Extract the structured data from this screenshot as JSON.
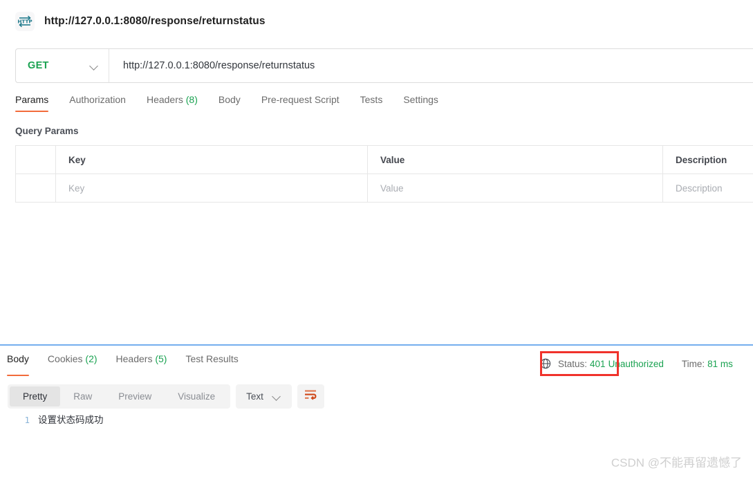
{
  "titlebar": {
    "icon": "http-protocol-icon",
    "title": "http://127.0.0.1:8080/response/returnstatus"
  },
  "request": {
    "method": "GET",
    "method_color": "#1aa251",
    "url": "http://127.0.0.1:8080/response/returnstatus",
    "tabs": [
      {
        "label": "Params",
        "count": "",
        "active": true
      },
      {
        "label": "Authorization",
        "count": "",
        "active": false
      },
      {
        "label": "Headers",
        "count": "(8)",
        "active": false
      },
      {
        "label": "Body",
        "count": "",
        "active": false
      },
      {
        "label": "Pre-request Script",
        "count": "",
        "active": false
      },
      {
        "label": "Tests",
        "count": "",
        "active": false
      },
      {
        "label": "Settings",
        "count": "",
        "active": false
      }
    ],
    "params_section_title": "Query Params",
    "params_table": {
      "headers": [
        "",
        "Key",
        "Value",
        "Description"
      ],
      "placeholder_row": [
        "",
        "Key",
        "Value",
        "Description"
      ]
    }
  },
  "response": {
    "tabs": [
      {
        "label": "Body",
        "count": "",
        "active": true
      },
      {
        "label": "Cookies",
        "count": "(2)",
        "active": false
      },
      {
        "label": "Headers",
        "count": "(5)",
        "active": false
      },
      {
        "label": "Test Results",
        "count": "",
        "active": false
      }
    ],
    "status_icon": "globe-icon",
    "status_label": "Status:",
    "status_code": "401",
    "status_text": "Unauthorized",
    "time_label": "Time:",
    "time_value": "81 ms",
    "status_color": "#1aa251",
    "highlight_color": "#f0322b",
    "view_modes": [
      {
        "label": "Pretty",
        "active": true
      },
      {
        "label": "Raw",
        "active": false
      },
      {
        "label": "Preview",
        "active": false
      },
      {
        "label": "Visualize",
        "active": false
      }
    ],
    "format": "Text",
    "wrap_icon": "word-wrap-icon",
    "body_lines": [
      {
        "number": "1",
        "text": "设置状态码成功"
      }
    ]
  },
  "watermark": "CSDN @不能再留遗憾了"
}
